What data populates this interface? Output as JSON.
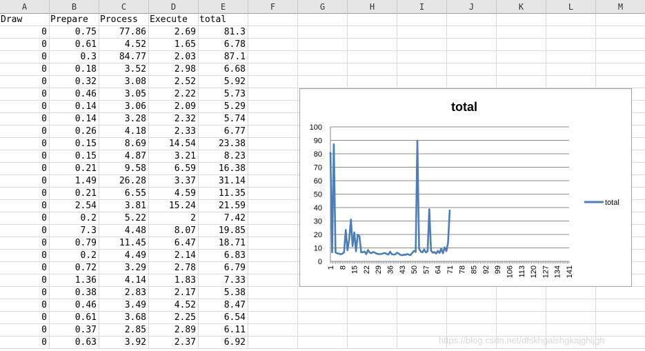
{
  "columns": [
    "A",
    "B",
    "C",
    "D",
    "E",
    "F",
    "G",
    "H",
    "I",
    "J",
    "K",
    "L",
    "M"
  ],
  "headers": [
    "Draw",
    "Prepare",
    "Process",
    "Execute",
    "total"
  ],
  "rows": [
    [
      "0",
      "0.75",
      "77.86",
      "2.69",
      "81.3"
    ],
    [
      "0",
      "0.61",
      "4.52",
      "1.65",
      "6.78"
    ],
    [
      "0",
      "0.3",
      "84.77",
      "2.03",
      "87.1"
    ],
    [
      "0",
      "0.18",
      "3.52",
      "2.98",
      "6.68"
    ],
    [
      "0",
      "0.32",
      "3.08",
      "2.52",
      "5.92"
    ],
    [
      "0",
      "0.46",
      "3.05",
      "2.22",
      "5.73"
    ],
    [
      "0",
      "0.14",
      "3.06",
      "2.09",
      "5.29"
    ],
    [
      "0",
      "0.14",
      "3.28",
      "2.32",
      "5.74"
    ],
    [
      "0",
      "0.26",
      "4.18",
      "2.33",
      "6.77"
    ],
    [
      "0",
      "0.15",
      "8.69",
      "14.54",
      "23.38"
    ],
    [
      "0",
      "0.15",
      "4.87",
      "3.21",
      "8.23"
    ],
    [
      "0",
      "0.21",
      "9.58",
      "6.59",
      "16.38"
    ],
    [
      "0",
      "1.49",
      "26.28",
      "3.37",
      "31.14"
    ],
    [
      "0",
      "0.21",
      "6.55",
      "4.59",
      "11.35"
    ],
    [
      "0",
      "2.54",
      "3.81",
      "15.24",
      "21.59"
    ],
    [
      "0",
      "0.2",
      "5.22",
      "2",
      "7.42"
    ],
    [
      "0",
      "7.3",
      "4.48",
      "8.07",
      "19.85"
    ],
    [
      "0",
      "0.79",
      "11.45",
      "6.47",
      "18.71"
    ],
    [
      "0",
      "0.2",
      "4.49",
      "2.14",
      "6.83"
    ],
    [
      "0",
      "0.72",
      "3.29",
      "2.78",
      "6.79"
    ],
    [
      "0",
      "1.36",
      "4.14",
      "1.83",
      "7.33"
    ],
    [
      "0",
      "0.38",
      "2.83",
      "2.17",
      "5.38"
    ],
    [
      "0",
      "0.46",
      "3.49",
      "4.52",
      "8.47"
    ],
    [
      "0",
      "0.61",
      "3.68",
      "2.25",
      "6.54"
    ],
    [
      "0",
      "0.37",
      "2.85",
      "2.89",
      "6.11"
    ],
    [
      "0",
      "0.63",
      "3.92",
      "2.37",
      "6.92"
    ]
  ],
  "watermark": "https://blog.csdn.net/dfskhgalshgkajghljgh",
  "chart_data": {
    "type": "line",
    "title": "total",
    "ylim": [
      0,
      100
    ],
    "yticks": [
      0,
      10,
      20,
      30,
      40,
      50,
      60,
      70,
      80,
      90,
      100
    ],
    "xlim": [
      1,
      141
    ],
    "xticks": [
      1,
      8,
      15,
      22,
      29,
      36,
      43,
      50,
      57,
      64,
      71,
      78,
      85,
      92,
      99,
      106,
      113,
      120,
      127,
      134,
      141
    ],
    "grid": "horizontal",
    "legend": "right",
    "line_color": "#4a7ebb",
    "series": [
      {
        "name": "total",
        "values": [
          81.3,
          6.78,
          87.1,
          6.68,
          5.92,
          5.73,
          5.29,
          5.74,
          6.77,
          23.38,
          8.23,
          16.38,
          31.14,
          11.35,
          21.59,
          7.42,
          19.85,
          18.71,
          6.83,
          6.79,
          7.33,
          5.38,
          8.47,
          6.54,
          6.11,
          6.92,
          6.5,
          5.8,
          5.5,
          5.4,
          5.6,
          5.9,
          6.2,
          5.5,
          5.1,
          7.2,
          5.3,
          5.1,
          5.2,
          6.4,
          5.8,
          4.9,
          4.5,
          5.0,
          4.8,
          5.4,
          5.0,
          4.7,
          6.3,
          7.8,
          7.0,
          89.6,
          9.5,
          7.2,
          6.8,
          8.9,
          6.6,
          7.5,
          38.8,
          8.1,
          6.4,
          6.9,
          5.8,
          7.8,
          6.2,
          9.5,
          6.0,
          10.4,
          7.6,
          14.0,
          38.5
        ]
      }
    ]
  }
}
